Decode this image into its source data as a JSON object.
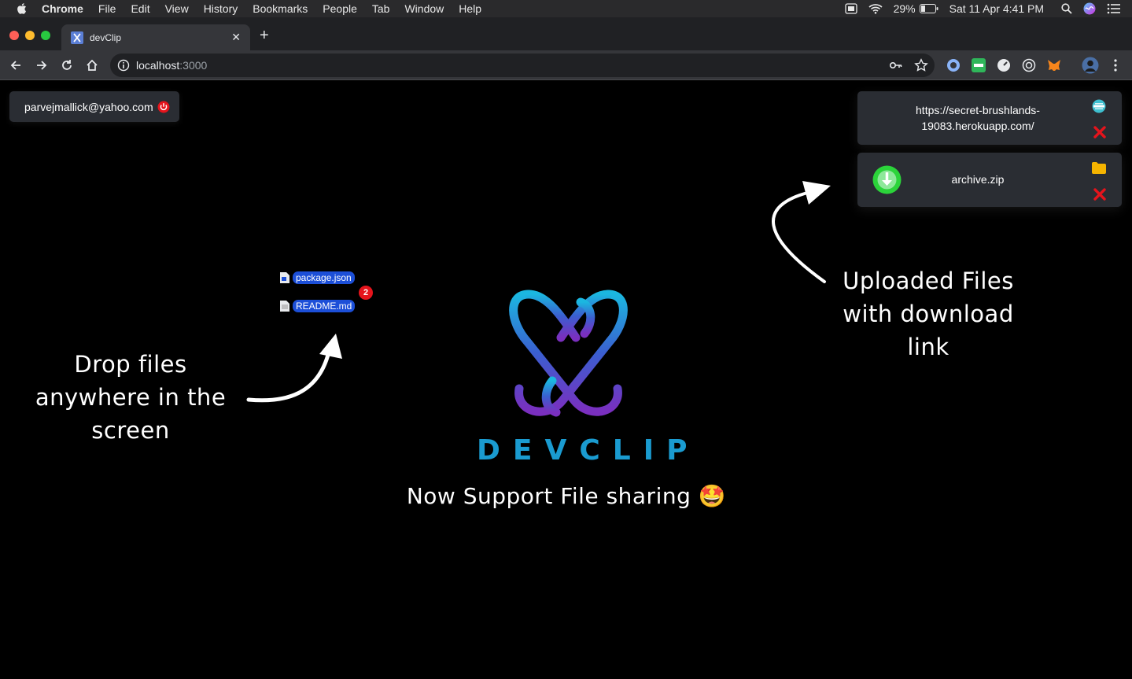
{
  "menubar": {
    "items": [
      "Chrome",
      "File",
      "Edit",
      "View",
      "History",
      "Bookmarks",
      "People",
      "Tab",
      "Window",
      "Help"
    ],
    "battery": "29%",
    "clock": "Sat 11 Apr  4:41 PM"
  },
  "browser": {
    "tab_title": "devClip",
    "url_host": "localhost",
    "url_port": ":3000"
  },
  "user": {
    "email": "parvejmallick@yahoo.com"
  },
  "uploads": [
    {
      "label": "https://secret-brushlands-19083.herokuapp.com/",
      "icon": "link-icon",
      "accent": "#3ec0d0"
    },
    {
      "label": "archive.zip",
      "icon": "folder-icon",
      "accent": "#f5b400"
    }
  ],
  "dragged_files": {
    "files": [
      "package.json",
      "README.md"
    ],
    "count": "2"
  },
  "annotations": {
    "drop": "Drop files anywhere in the screen",
    "uploaded": "Uploaded Files with download link"
  },
  "brand": {
    "name": "DEVCLIP",
    "tagline": "Now Support File sharing 🤩"
  },
  "colors": {
    "accent_blue": "#1a9bd0",
    "accent_purple": "#7a2fbf",
    "delete_red": "#e5141c",
    "download_green": "#2bd43a"
  }
}
